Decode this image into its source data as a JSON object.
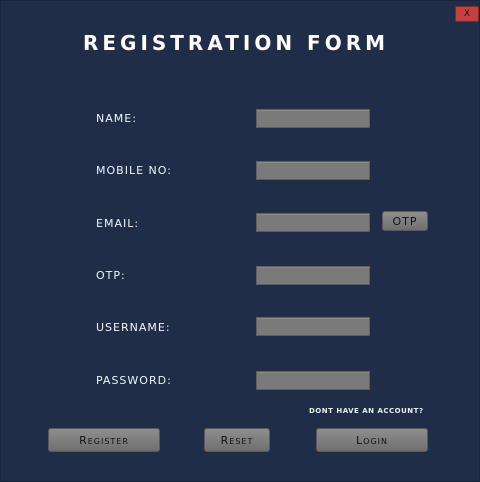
{
  "window": {
    "close_label": "X"
  },
  "title": "REGISTRATION FORM",
  "fields": [
    {
      "label": "NAME:",
      "value": ""
    },
    {
      "label": "MOBILE NO:",
      "value": ""
    },
    {
      "label": "EMAIL:",
      "value": ""
    },
    {
      "label": "OTP:",
      "value": ""
    },
    {
      "label": "USERNAME:",
      "value": ""
    },
    {
      "label": "PASSWORD:",
      "value": ""
    }
  ],
  "otp_button": "OTP",
  "hint": "DONT HAVE AN ACCOUNT?",
  "buttons": {
    "register": "Register",
    "reset": "Reset",
    "login": "Login"
  },
  "colors": {
    "background": "#1f2d48",
    "field": "#7a7a7a",
    "close": "#c6403f"
  }
}
